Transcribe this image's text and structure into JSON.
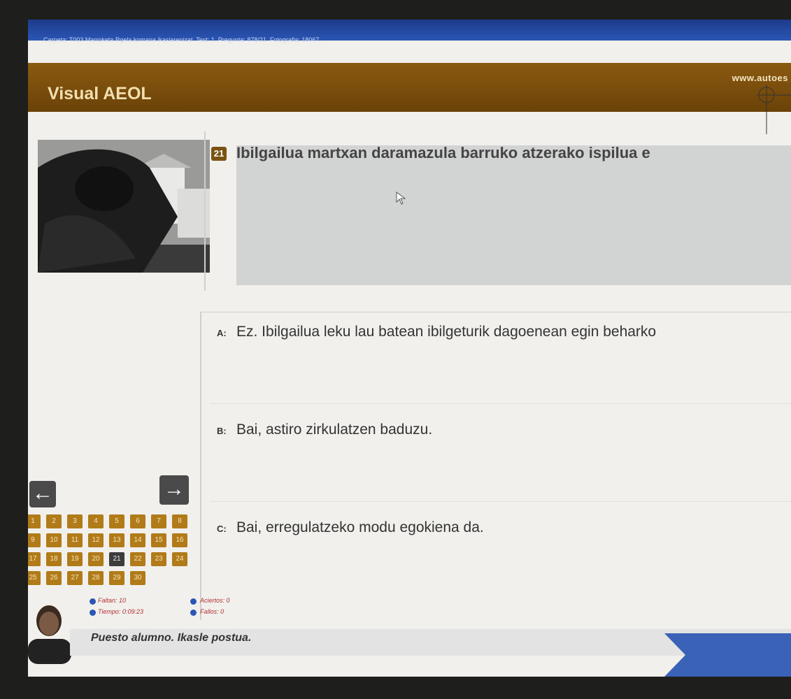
{
  "info_bar": {
    "text": "Carpeta: T003 Marroketa Rgela komana ikasiarenizat. Test: 1. Pregunta: 878/21. Fotografia: 18067."
  },
  "header": {
    "app_title": "Visual AEOL",
    "website": "www.autoes"
  },
  "question": {
    "number": "21",
    "text": "Ibilgailua martxan daramazula barruko atzerako ispilua e"
  },
  "answers": [
    {
      "letter": "A:",
      "text": "Ez. Ibilgailua leku lau batean ibilgeturik dagoenean egin beharko"
    },
    {
      "letter": "B:",
      "text": "Bai, astiro zirkulatzen baduzu."
    },
    {
      "letter": "C:",
      "text": "Bai, erregulatzeko modu egokiena da."
    }
  ],
  "navigation": {
    "prev_label": "←",
    "next_label": "→",
    "questions": [
      "1",
      "2",
      "3",
      "4",
      "5",
      "6",
      "7",
      "8",
      "9",
      "10",
      "11",
      "12",
      "13",
      "14",
      "15",
      "16",
      "17",
      "18",
      "19",
      "20",
      "21",
      "22",
      "23",
      "24",
      "25",
      "26",
      "27",
      "28",
      "29",
      "30"
    ],
    "current": "21"
  },
  "stats": {
    "faltan": "Faltan: 10",
    "tiempo": "Tiempo: 0:09:23",
    "aciertos": "Aciertos: 0",
    "fallos": "Fallos: 0"
  },
  "status": {
    "text": "Puesto alumno. Ikasle postua."
  },
  "colors": {
    "info_bar": "#2b56b5",
    "brand_bar": "#6b4208",
    "nav_cell": "#b27b1a",
    "question_box": "#d2d3d3"
  }
}
